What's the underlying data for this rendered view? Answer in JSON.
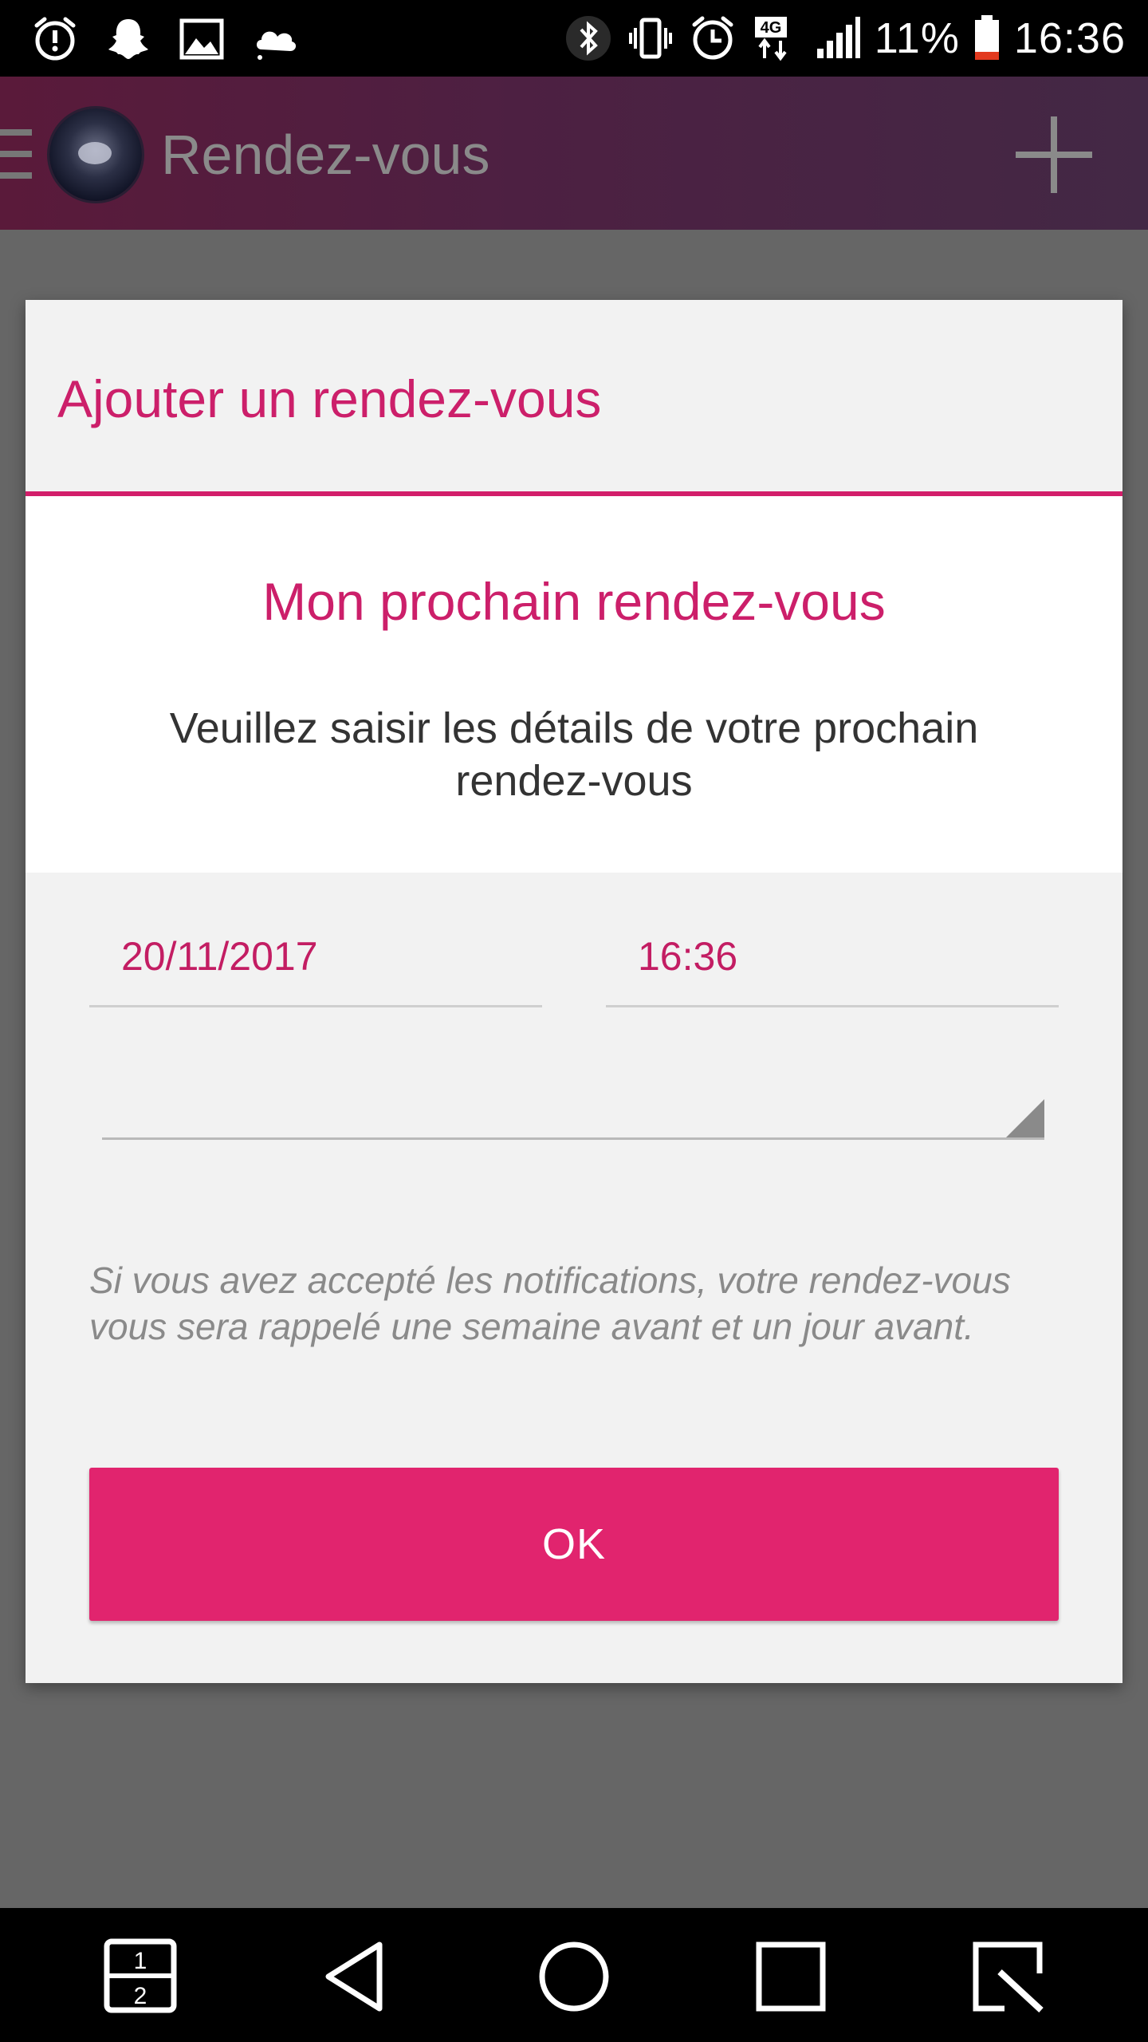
{
  "statusbar": {
    "battery_percent": "11%",
    "time": "16:36",
    "network": "4G",
    "left_icons": [
      "alarm-alert-icon",
      "snapchat-icon",
      "image-icon",
      "weather-icon"
    ],
    "right_icons": [
      "bluetooth-icon",
      "vibrate-icon",
      "alarm-icon",
      "network-4g-icon",
      "signal-icon",
      "battery-icon"
    ]
  },
  "toolbar": {
    "title": "Rendez-vous",
    "menu_icon": "menu-icon",
    "add_icon": "add-icon"
  },
  "dialog": {
    "title": "Ajouter un rendez-vous",
    "heading": "Mon prochain rendez-vous",
    "description": "Veuillez saisir les détails de votre prochain rendez-vous",
    "date_value": "20/11/2017",
    "time_value": "16:36",
    "select_value": "",
    "note": "Si vous avez accepté les notifications, votre rendez-vous vous sera rappelé une semaine avant et un jour avant.",
    "ok_label": "OK"
  },
  "navbar": {
    "buttons": [
      "dual-window-icon",
      "back-icon",
      "home-icon",
      "recents-icon",
      "qslide-icon"
    ]
  },
  "colors": {
    "accent": "#cc1f6a",
    "button": "#e1246e",
    "scrim": "#666666"
  }
}
